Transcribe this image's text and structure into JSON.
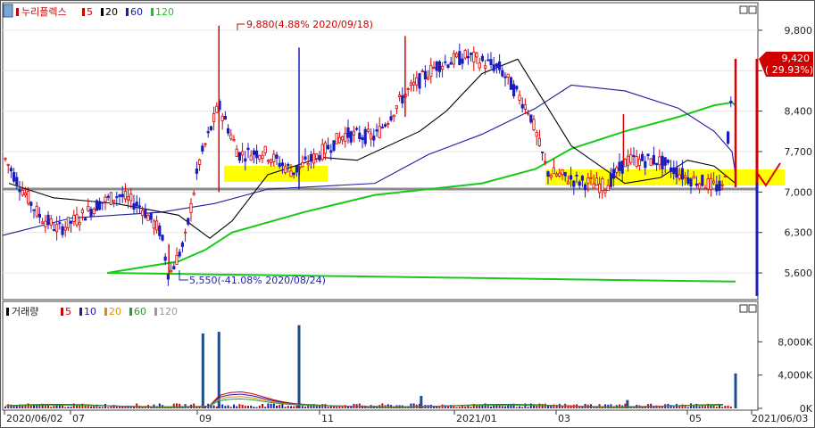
{
  "price_panel": {
    "legend": {
      "title": "누리플렉스",
      "items": [
        {
          "label": "5",
          "color": "#cc0000"
        },
        {
          "label": "20",
          "color": "#000000"
        },
        {
          "label": "60",
          "color": "#1c1c9c"
        },
        {
          "label": "120",
          "color": "#19c919"
        }
      ]
    },
    "max_annotation": "9,880(4.88% 2020/09/18)",
    "min_annotation": "5,550(-41.08% 2020/08/24)",
    "current_price": "9,420",
    "current_change": "( 29.93%)",
    "y_ticks": [
      "9,800",
      "9,100",
      "8,400",
      "7,700",
      "7,000",
      "6,300",
      "5,600"
    ]
  },
  "volume_panel": {
    "legend": {
      "title": "거래량",
      "items": [
        {
          "label": "5",
          "color": "#cc0000"
        },
        {
          "label": "10",
          "color": "#1c1c9c"
        },
        {
          "label": "20",
          "color": "#e08a00"
        },
        {
          "label": "60",
          "color": "#2b9b2b"
        },
        {
          "label": "120",
          "color": "#9a9a9a"
        }
      ]
    },
    "y_ticks": [
      "8,000K",
      "4,000K",
      "0K"
    ]
  },
  "x_labels": [
    "2020/06/02",
    "07",
    "09",
    "11",
    "2021/01",
    "03",
    "05",
    "2021/06/03"
  ],
  "chart_data": {
    "type": "candlestick",
    "title": "누리플렉스",
    "x_range": [
      "2020/06/02",
      "2021/06/03"
    ],
    "y_range": [
      5200,
      10200
    ],
    "y_ticks": [
      9800,
      9100,
      8400,
      7700,
      7000,
      6300,
      5600
    ],
    "highlights": [
      {
        "type": "high",
        "date": "2020/09/18",
        "value": 9880,
        "label": "9,880(4.88% 2020/09/18)"
      },
      {
        "type": "low",
        "date": "2020/08/24",
        "value": 5550,
        "label": "5,550(-41.08% 2020/08/24)"
      },
      {
        "type": "last",
        "date": "2021/06/03",
        "value": 9420,
        "label": "9,420 (29.93%)"
      }
    ],
    "price_path": [
      {
        "date": "2020/06/02",
        "close": 7650
      },
      {
        "date": "2020/06/10",
        "close": 7150
      },
      {
        "date": "2020/06/20",
        "close": 6600
      },
      {
        "date": "2020/06/30",
        "close": 6350
      },
      {
        "date": "2020/07/10",
        "close": 6550
      },
      {
        "date": "2020/07/20",
        "close": 6800
      },
      {
        "date": "2020/07/30",
        "close": 6950
      },
      {
        "date": "2020/08/10",
        "close": 6750
      },
      {
        "date": "2020/08/20",
        "close": 6300
      },
      {
        "date": "2020/08/24",
        "close": 5550
      },
      {
        "date": "2020/09/01",
        "close": 6150
      },
      {
        "date": "2020/09/08",
        "close": 7500
      },
      {
        "date": "2020/09/18",
        "close": 8500
      },
      {
        "date": "2020/09/28",
        "close": 7650
      },
      {
        "date": "2020/10/10",
        "close": 7700
      },
      {
        "date": "2020/10/25",
        "close": 7350
      },
      {
        "date": "2020/11/05",
        "close": 7600
      },
      {
        "date": "2020/11/20",
        "close": 8000
      },
      {
        "date": "2020/12/05",
        "close": 7950
      },
      {
        "date": "2020/12/20",
        "close": 8700
      },
      {
        "date": "2021/01/05",
        "close": 9200
      },
      {
        "date": "2021/01/20",
        "close": 9350
      },
      {
        "date": "2021/02/05",
        "close": 9150
      },
      {
        "date": "2021/02/20",
        "close": 8400
      },
      {
        "date": "2021/03/01",
        "close": 7350
      },
      {
        "date": "2021/03/15",
        "close": 7200
      },
      {
        "date": "2021/03/30",
        "close": 7100
      },
      {
        "date": "2021/04/10",
        "close": 7550
      },
      {
        "date": "2021/04/25",
        "close": 7550
      },
      {
        "date": "2021/05/10",
        "close": 7250
      },
      {
        "date": "2021/05/28",
        "close": 7050
      },
      {
        "date": "2021/06/03",
        "close": 9420
      }
    ],
    "ma_series": [
      {
        "name": "120",
        "color": "#19c919",
        "values": [
          5450,
          5600,
          5800,
          6000,
          6300,
          6650,
          6950,
          7050,
          7150,
          7400,
          7750,
          8050,
          8300,
          8500,
          8550,
          8500,
          8450,
          8380
        ]
      },
      {
        "name": "60",
        "color": "#1c1c9c",
        "values": [
          6250,
          6550,
          6650,
          6800,
          7050,
          7150,
          7650,
          8000,
          8450,
          8850,
          8750,
          8450,
          8050,
          7700,
          7300
        ]
      },
      {
        "name": "20",
        "color": "#000000",
        "values": [
          7150,
          6900,
          6800,
          6600,
          6200,
          6500,
          7300,
          7600,
          7550,
          8050,
          8400,
          9050,
          9300,
          8800,
          7800,
          7150,
          7250,
          7550,
          7450,
          7150
        ]
      }
    ],
    "volume_spikes": [
      {
        "date": "2020/09/10",
        "value": 9000
      },
      {
        "date": "2020/09/18",
        "value": 9200
      },
      {
        "date": "2020/10/28",
        "value": 10000
      },
      {
        "date": "2020/12/28",
        "value": 1500
      },
      {
        "date": "2021/04/10",
        "value": 1000
      },
      {
        "date": "2021/06/03",
        "value": 4200
      }
    ],
    "volume_range": [
      0,
      10500
    ]
  }
}
